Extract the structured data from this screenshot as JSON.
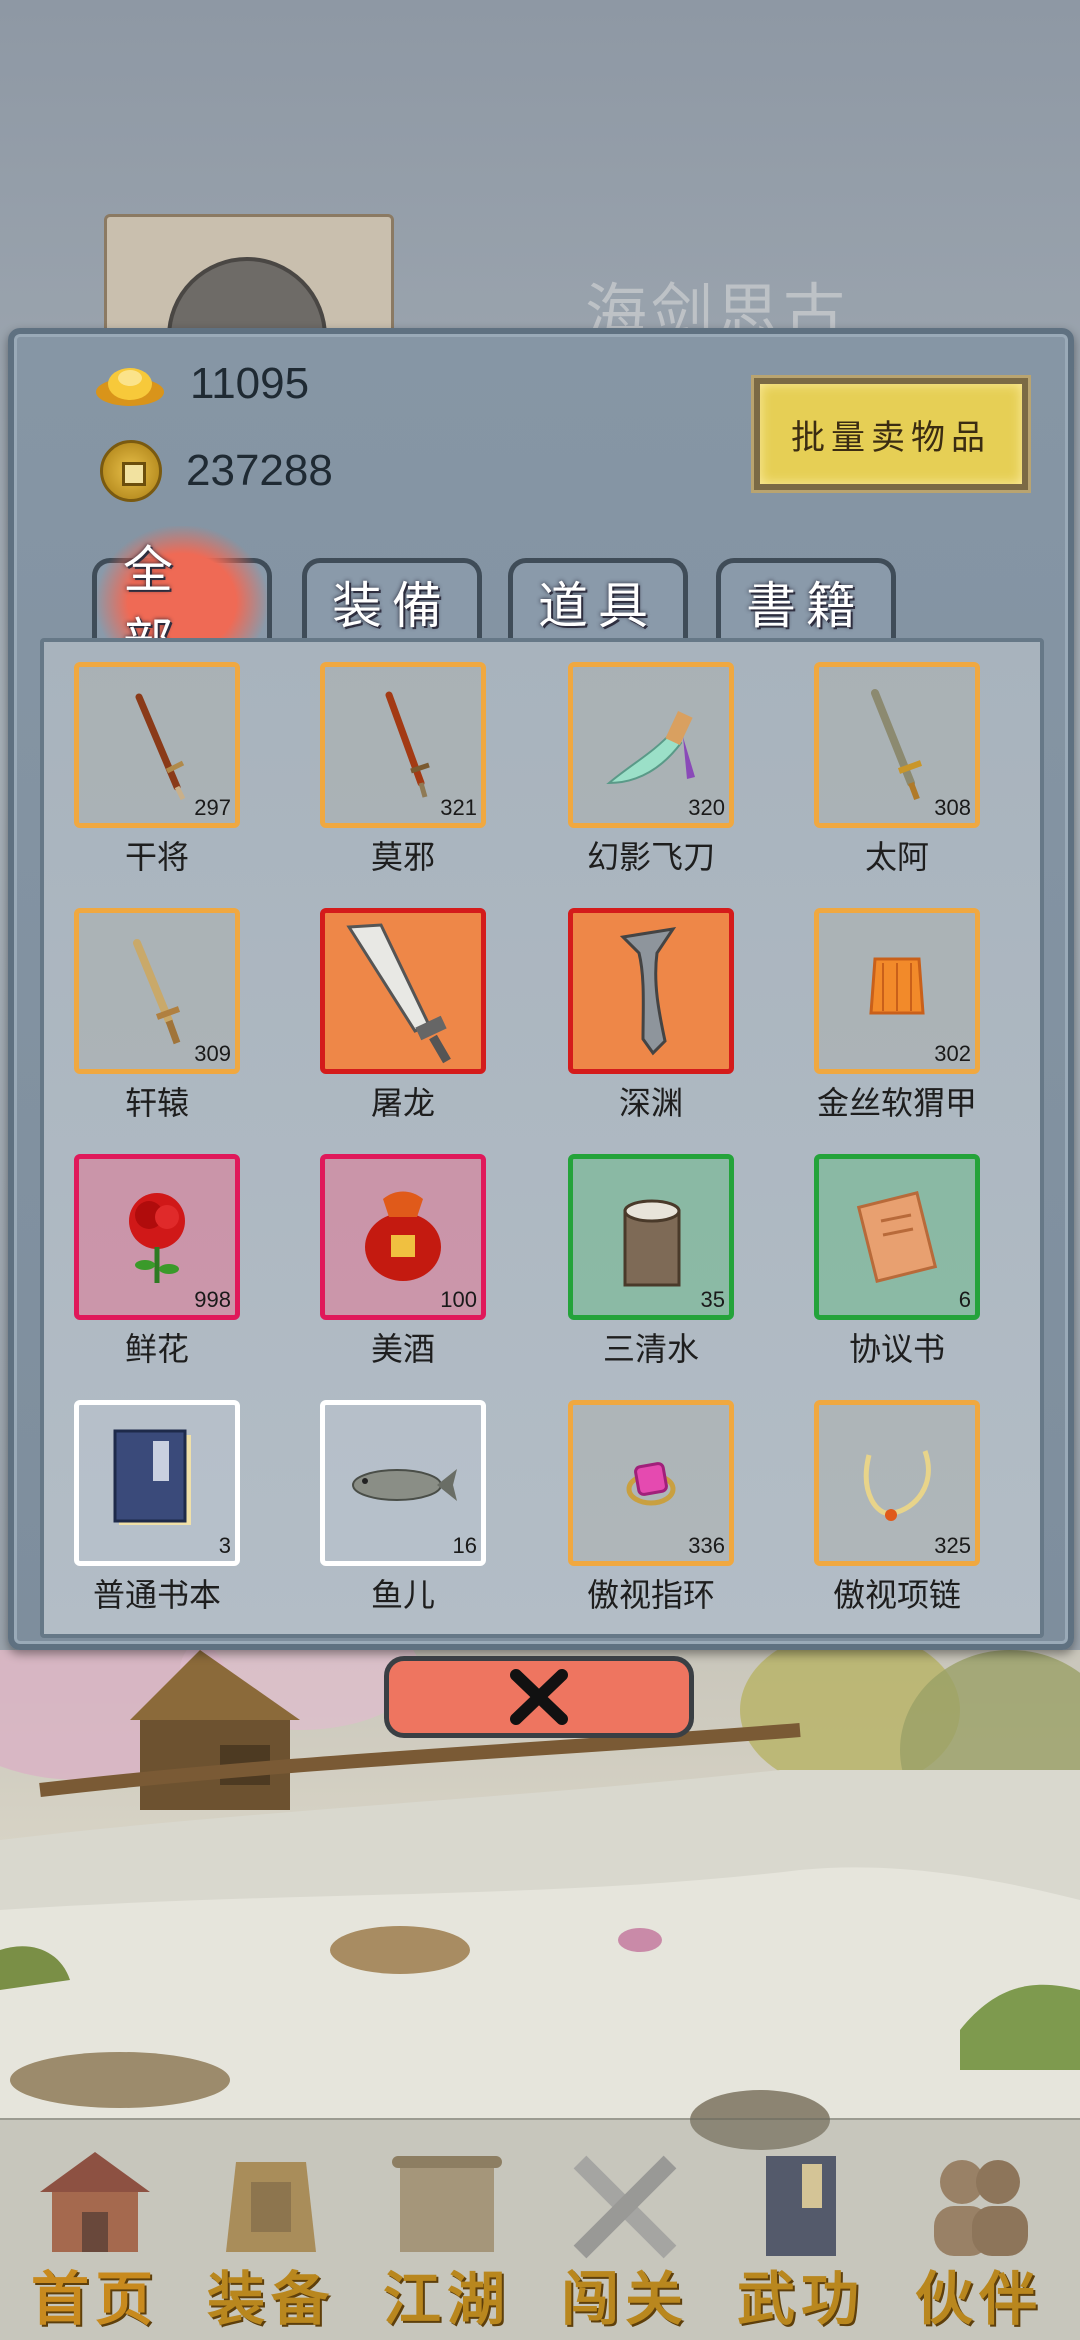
{
  "player": {
    "name": "海剑思古"
  },
  "inventory": {
    "gold_ingots": "11095",
    "copper_coins": "237288",
    "bulk_sell_label": "批量卖物品",
    "tabs": [
      {
        "label": "全部",
        "active": true
      },
      {
        "label": "装備",
        "active": false
      },
      {
        "label": "道具",
        "active": false
      },
      {
        "label": "書籍",
        "active": false
      }
    ],
    "items": [
      {
        "name": "干将",
        "count": "297",
        "quality": "orange",
        "icon": "sword-icon"
      },
      {
        "name": "莫邪",
        "count": "321",
        "quality": "orange",
        "icon": "sword-icon"
      },
      {
        "name": "幻影飞刀",
        "count": "320",
        "quality": "orange",
        "icon": "flying-dagger-icon"
      },
      {
        "name": "太阿",
        "count": "308",
        "quality": "orange",
        "icon": "sword-icon"
      },
      {
        "name": "轩辕",
        "count": "309",
        "quality": "orange",
        "icon": "sword-icon"
      },
      {
        "name": "屠龙",
        "count": "",
        "quality": "red",
        "icon": "broadsword-icon"
      },
      {
        "name": "深渊",
        "count": "",
        "quality": "red",
        "icon": "curved-blade-icon"
      },
      {
        "name": "金丝软猬甲",
        "count": "302",
        "quality": "orange",
        "icon": "armor-icon"
      },
      {
        "name": "鲜花",
        "count": "998",
        "quality": "pink",
        "icon": "rose-icon"
      },
      {
        "name": "美酒",
        "count": "100",
        "quality": "pink",
        "icon": "wine-jar-icon"
      },
      {
        "name": "三清水",
        "count": "35",
        "quality": "green",
        "icon": "water-bucket-icon"
      },
      {
        "name": "协议书",
        "count": "6",
        "quality": "green",
        "icon": "contract-scroll-icon"
      },
      {
        "name": "普通书本",
        "count": "3",
        "quality": "white",
        "icon": "book-icon"
      },
      {
        "name": "鱼儿",
        "count": "16",
        "quality": "white",
        "icon": "fish-icon"
      },
      {
        "name": "傲视指环",
        "count": "336",
        "quality": "orange",
        "icon": "ring-icon"
      },
      {
        "name": "傲视项链",
        "count": "325",
        "quality": "orange",
        "icon": "necklace-icon"
      }
    ],
    "close_icon": "close-icon"
  },
  "bottom_nav": [
    {
      "label": "首页",
      "icon": "house-icon",
      "active": true
    },
    {
      "label": "装备",
      "icon": "armor-icon",
      "active": false
    },
    {
      "label": "江湖",
      "icon": "scroll-icon",
      "active": false
    },
    {
      "label": "闯关",
      "icon": "crossed-swords-icon",
      "active": false
    },
    {
      "label": "武功",
      "icon": "martial-book-icon",
      "active": false
    },
    {
      "label": "伙伴",
      "icon": "companions-icon",
      "active": false
    }
  ],
  "colors": {
    "quality_orange": "#f0a840",
    "quality_red": "#d41b1b",
    "quality_pink": "#e0185a",
    "quality_green": "#24a33a",
    "quality_white": "#ffffff",
    "bulk_sell_bg": "#e6cf55",
    "close_bg": "#ee7560",
    "nav_label": "#b9871e"
  }
}
